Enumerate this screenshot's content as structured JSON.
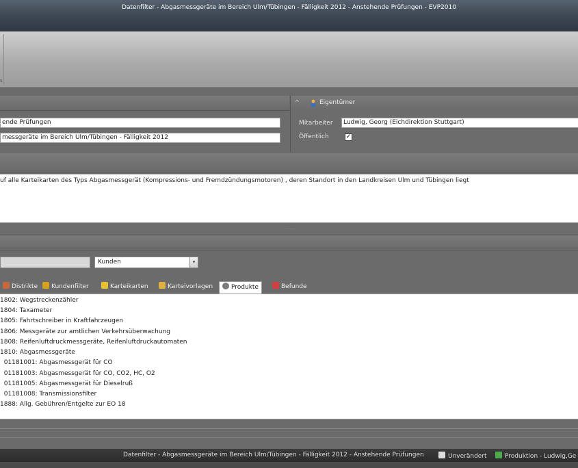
{
  "window": {
    "title": "Datenfilter - Abgasmessgeräte im Bereich Ulm/Tübingen - Fälligkeit 2012 - Anstehende Prüfungen - EVP2010"
  },
  "ribbon": {
    "tick": "s"
  },
  "general": {
    "field1": "ende Prüfungen",
    "field2": "messgeräte im Bereich Ulm/Tübingen - Fälligkeit 2012"
  },
  "owner": {
    "chevron": "^",
    "title": "Eigentümer",
    "mitarbeiter_label": "Mitarbeiter",
    "mitarbeiter_value": "Ludwig, Georg (Eichdirektion Stuttgart)",
    "oeffentlich_label": "Öffentlich",
    "oeffentlich_check": "✓"
  },
  "description": {
    "text": "uf alle Karteikarten des Typs Abgasmessgerät (Kompressions- und Fremdzündungsmotoren) , deren Standort in den Landkreisen Ulm und Tübingen liegt"
  },
  "splitter": {
    "grip": "....."
  },
  "filter": {
    "combo_value": "Kunden"
  },
  "tabs": [
    {
      "label": "Distrikte",
      "color": "#c8683a"
    },
    {
      "label": "Kundenfilter",
      "color": "#d8a020"
    },
    {
      "label": "Karteikarten",
      "color": "#e8c030"
    },
    {
      "label": "Karteivorlagen",
      "color": "#e0b040"
    },
    {
      "label": "Produkte",
      "color": "#7a7a7a"
    },
    {
      "label": "Befunde",
      "color": "#d04040"
    }
  ],
  "products": [
    "1802: Wegstreckenzähler",
    "1804: Taxameter",
    "1805: Fahrtschreiber in Kraftfahrzeugen",
    "1806: Messgeräte zur amtlichen Verkehrsüberwachung",
    "1808: Reifenluftdruckmessgeräte, Reifenluftdruckautomaten",
    "1810: Abgasmessgeräte",
    "  01181001: Abgasmessgerät für CO",
    "  01181003: Abgasmessgerät für CO, CO2, HC, O2",
    "  01181005: Abgasmessgerät für Dieselruß",
    "  01181008: Transmissionsfilter",
    "1888: Allg. Gebühren/Entgelte zur EO 18"
  ],
  "status": {
    "title": "Datenfilter - Abgasmessgeräte im Bereich Ulm/Tübingen - Fälligkeit 2012 - Anstehende Prüfungen",
    "state": "Unverändert",
    "env": "Produktion - Ludwig,Ge"
  }
}
